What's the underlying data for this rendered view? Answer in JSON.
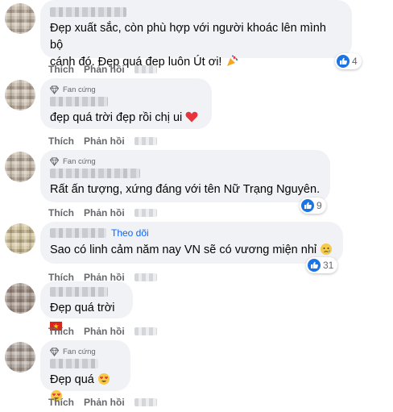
{
  "badge_label": "Fan cứng",
  "follow_label": "Theo dõi",
  "actions": {
    "like": "Thích",
    "reply": "Phản hồi"
  },
  "comments": [
    {
      "text_line1": "Đẹp xuất sắc, còn phù hợp với người khoác lên mình bộ",
      "text_line2": "cánh đó. Đẹp quá đẹp luôn Út ơi!",
      "emoji": "party-popper",
      "reaction_count": "4"
    },
    {
      "text": "đẹp quá trời đẹp rồi chị ui",
      "emoji": "red-heart",
      "badge": true
    },
    {
      "text": "Rất ấn tượng, xứng đáng với tên Nữ Trạng Nguyên.",
      "reaction_count": "9",
      "badge": true
    },
    {
      "text": "Sao có linh cảm năm nay VN sẽ có vương miện nhỉ",
      "emoji": "teary-face",
      "reaction_count": "31",
      "follow": true
    },
    {
      "text": "Đẹp quá trời",
      "emoji": "vietnam-flag"
    },
    {
      "text": "Đẹp quá",
      "emoji": "heart-eyes-face",
      "badge": true
    }
  ]
}
